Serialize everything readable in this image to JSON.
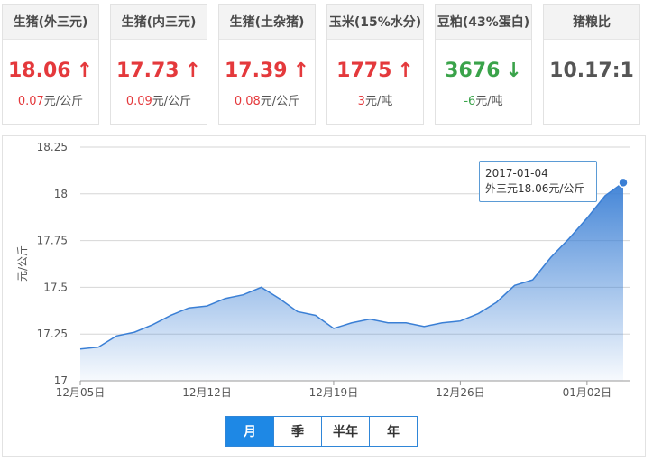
{
  "cards": [
    {
      "title": "生猪(外三元)",
      "value": "18.06",
      "arrow": "↑",
      "dir": "up",
      "change": "0.07",
      "unit": "元/公斤"
    },
    {
      "title": "生猪(内三元)",
      "value": "17.73",
      "arrow": "↑",
      "dir": "up",
      "change": "0.09",
      "unit": "元/公斤"
    },
    {
      "title": "生猪(土杂猪)",
      "value": "17.39",
      "arrow": "↑",
      "dir": "up",
      "change": "0.08",
      "unit": "元/公斤"
    },
    {
      "title": "玉米(15%水分)",
      "value": "1775",
      "arrow": "↑",
      "dir": "up",
      "change": "3",
      "unit": "元/吨"
    },
    {
      "title": "豆粕(43%蛋白)",
      "value": "3676",
      "arrow": "↓",
      "dir": "down",
      "change": "-6",
      "unit": "元/吨"
    },
    {
      "title": "猪粮比",
      "value": "10.17:1",
      "arrow": "",
      "dir": "flat",
      "change": "",
      "unit": ""
    }
  ],
  "tooltip": {
    "date": "2017-01-04",
    "text": "外三元18.06元/公斤"
  },
  "range_buttons": [
    "月",
    "季",
    "半年",
    "年"
  ],
  "active_range": "月",
  "colors": {
    "up": "#e4393c",
    "down": "#3aa34a",
    "series": "#3a7fd5",
    "accent": "#1e88e5"
  },
  "chart_data": {
    "type": "area",
    "ylabel": "元/公斤",
    "ylim": [
      17,
      18.25
    ],
    "yticks": [
      17,
      17.25,
      17.5,
      17.75,
      18,
      18.25
    ],
    "ytick_labels": [
      "17",
      "17.25",
      "17.5",
      "17.75",
      "18",
      "18.25"
    ],
    "xtick_labels": [
      "12月05日",
      "12月12日",
      "12月19日",
      "12月26日",
      "01月02日"
    ],
    "xtick_index": [
      0,
      7,
      14,
      21,
      28
    ],
    "grid": true,
    "series": [
      {
        "values": [
          17.17,
          17.18,
          17.24,
          17.26,
          17.3,
          17.35,
          17.39,
          17.4,
          17.44,
          17.46,
          17.5,
          17.44,
          17.37,
          17.35,
          17.28,
          17.31,
          17.33,
          17.31,
          17.31,
          17.29,
          17.31,
          17.32,
          17.36,
          17.42,
          17.51,
          17.54,
          17.66,
          17.76,
          17.87,
          17.99,
          18.06
        ]
      }
    ]
  }
}
